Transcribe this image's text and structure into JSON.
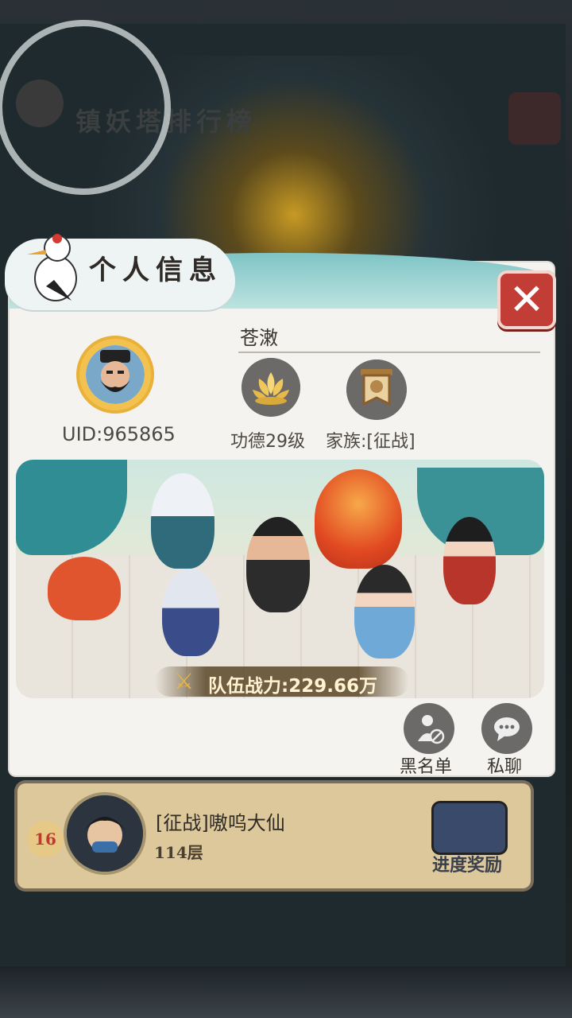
{
  "background": {
    "leaderboard_title": "镇妖塔排行榜"
  },
  "profile_panel": {
    "title": "个人信息",
    "player_name": "苍潄",
    "uid_label": "UID:965865",
    "merit_label": "功德29级",
    "family_label": "家族:[征战]",
    "team_power_label": "队伍战力:229.66万",
    "blacklist_label": "黑名单",
    "private_chat_label": "私聊",
    "icons": {
      "close": "close-icon",
      "avatar": "player-avatar",
      "merit": "lotus-icon",
      "family": "family-banner-icon",
      "power": "crossed-swords-icon",
      "blacklist": "blacklist-person-icon",
      "chat": "chat-bubble-icon"
    }
  },
  "rank_entry": {
    "rank": "16",
    "name": "[征战]嗷呜大仙",
    "floor": "114层",
    "reward_label": "进度奖励"
  },
  "colors": {
    "accent_red": "#c23d36",
    "panel_bg": "#f5f3f0",
    "rank_bg": "#dcc89a"
  }
}
